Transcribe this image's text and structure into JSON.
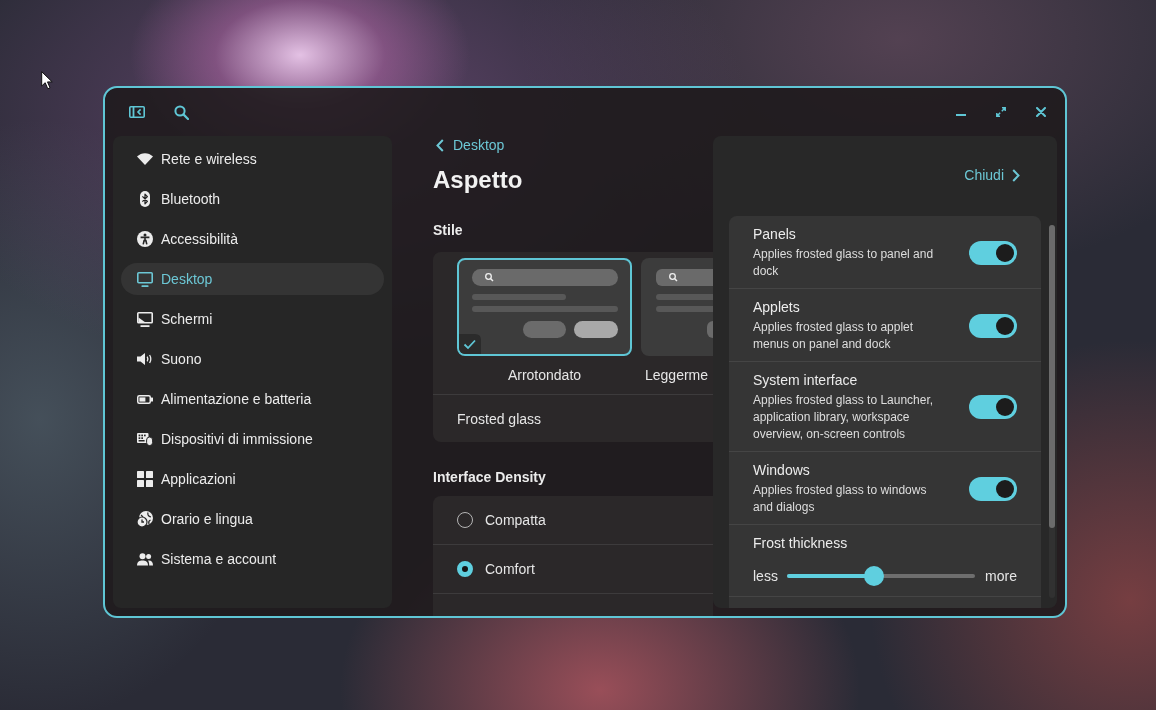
{
  "sidebar": {
    "items": [
      {
        "label": "Rete e wireless",
        "selected": false
      },
      {
        "label": "Bluetooth",
        "selected": false
      },
      {
        "label": "Accessibilità",
        "selected": false
      },
      {
        "label": "Desktop",
        "selected": true
      },
      {
        "label": "Schermi",
        "selected": false
      },
      {
        "label": "Suono",
        "selected": false
      },
      {
        "label": "Alimentazione e batteria",
        "selected": false
      },
      {
        "label": "Dispositivi di immissione",
        "selected": false
      },
      {
        "label": "Applicazioni",
        "selected": false
      },
      {
        "label": "Orario e lingua",
        "selected": false
      },
      {
        "label": "Sistema e account",
        "selected": false
      }
    ]
  },
  "page": {
    "back_link": "Desktop",
    "title": "Aspetto"
  },
  "style": {
    "heading": "Stile",
    "options": [
      {
        "label": "Arrotondato",
        "selected": true
      },
      {
        "label": "Leggerme",
        "selected": false
      }
    ],
    "frosted_glass": "Frosted glass"
  },
  "density": {
    "heading": "Interface Density",
    "options": [
      {
        "label": "Compatta",
        "selected": false
      },
      {
        "label": "Comfort",
        "selected": true
      }
    ]
  },
  "panel": {
    "close_link": "Chiudi",
    "rows": [
      {
        "kind": "toggle",
        "title": "Panels",
        "description": "Applies frosted glass to panel and dock",
        "on": true
      },
      {
        "kind": "toggle",
        "title": "Applets",
        "description": "Applies frosted glass to applet menus on panel and dock",
        "on": true
      },
      {
        "kind": "toggle",
        "title": "System interface",
        "description": "Applies frosted glass to Launcher, application library, workspace overview, on-screen controls",
        "on": true
      },
      {
        "kind": "toggle",
        "title": "Windows",
        "description": "Applies frosted glass to windows and dialogs",
        "on": true
      },
      {
        "kind": "slider",
        "title": "Frost thickness",
        "min_label": "less",
        "max_label": "more",
        "level": 0.465
      }
    ]
  }
}
